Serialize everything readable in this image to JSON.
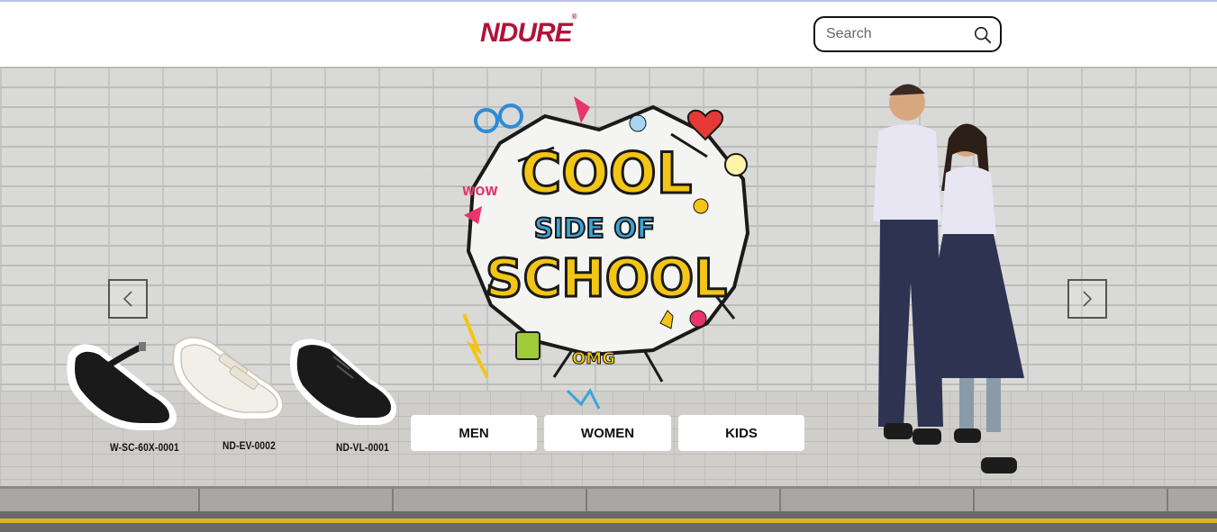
{
  "header": {
    "logo_text": "NDURE",
    "logo_mark": "®",
    "search": {
      "placeholder": "Search",
      "value": "",
      "icon": "search-icon"
    }
  },
  "hero": {
    "graffiti_line1": "COOL",
    "graffiti_line2": "SIDE OF",
    "graffiti_line3": "SCHOOL",
    "graffiti_wow": "WOW",
    "graffiti_omg": "OMG",
    "prev_icon": "chevron-left-icon",
    "next_icon": "chevron-right-icon",
    "shoes": [
      {
        "code": "W-SC-60X-0001",
        "color": "#1a1a1a"
      },
      {
        "code": "ND-EV-0002",
        "color": "#f2efe8"
      },
      {
        "code": "ND-VL-0001",
        "color": "#1a1a1a"
      }
    ],
    "categories": [
      {
        "label": "MEN"
      },
      {
        "label": "WOMEN"
      },
      {
        "label": "KIDS"
      }
    ]
  },
  "colors": {
    "brand": "#b0133a",
    "graffiti_yellow": "#f3c515",
    "uniform_shirt": "#e8e6f3",
    "uniform_navy": "#2e3352",
    "road_line": "#d9b42a"
  }
}
